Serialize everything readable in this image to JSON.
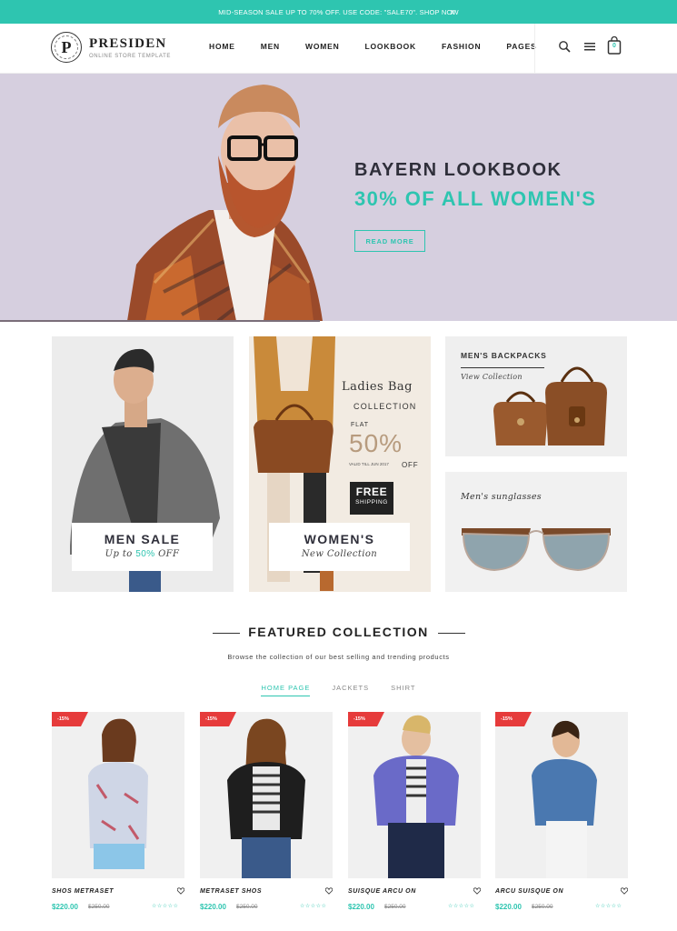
{
  "topbar": {
    "message": "MID-SEASON SALE UP TO 70% OFF. USE CODE: \"SALE70\". SHOP NOW",
    "close": "x"
  },
  "brand": {
    "name": "PRESIDEN",
    "tagline": "ONLINE STORE TEMPLATE",
    "mark": "P"
  },
  "nav": {
    "items": [
      "HOME",
      "MEN",
      "WOMEN",
      "LOOKBOOK",
      "FASHION",
      "PAGES"
    ]
  },
  "header_icons": [
    "search-icon",
    "menu-icon",
    "cart-icon"
  ],
  "cart": {
    "count": "0"
  },
  "hero": {
    "title": "BAYERN LOOKBOOK",
    "subtitle": "30% OF ALL WOMEN'S",
    "button": "READ MORE"
  },
  "banners": {
    "men": {
      "title": "MEN SALE",
      "sub_prefix": "Up to ",
      "sub_highlight": "50%",
      "sub_suffix": " OFF"
    },
    "bag": {
      "title": "Ladies Bag",
      "collection": "COLLECTION",
      "flat": "FLAT",
      "percent": "50%",
      "valid": "VALID TILL JUN 2017",
      "off": "OFF",
      "free_1": "FREE",
      "free_2": "SHIPPING",
      "label_title": "WOMEN'S",
      "label_sub": "New Collection"
    },
    "backpacks": {
      "title": "MEN'S BACKPACKS",
      "sub": "View Collection"
    },
    "sunglasses": {
      "title": "Men's sunglasses"
    }
  },
  "featured": {
    "title": "FEATURED COLLECTION",
    "subtitle": "Browse the collection of our best selling and trending products",
    "tabs": [
      "HOME PAGE",
      "JACKETS",
      "SHIRT"
    ],
    "active_tab": "HOME PAGE"
  },
  "products": [
    {
      "badge": "-15%",
      "name": "SHOS METRASET",
      "price": "$220.00",
      "old_price": "$250.00",
      "stars": "☆☆☆☆☆"
    },
    {
      "badge": "-15%",
      "name": "METRASET SHOS",
      "price": "$220.00",
      "old_price": "$250.00",
      "stars": "☆☆☆☆☆"
    },
    {
      "badge": "-15%",
      "name": "SUISQUE ARCU ON",
      "price": "$220.00",
      "old_price": "$250.00",
      "stars": "☆☆☆☆☆"
    },
    {
      "badge": "-15%",
      "name": "ARCU SUISQUE ON",
      "price": "$220.00",
      "old_price": "$250.00",
      "stars": "☆☆☆☆☆"
    }
  ],
  "colors": {
    "accent": "#2ec5b0",
    "badge": "#e63b3b",
    "hero_bg": "#d6cfdf",
    "dark_text": "#2f2f3a"
  }
}
